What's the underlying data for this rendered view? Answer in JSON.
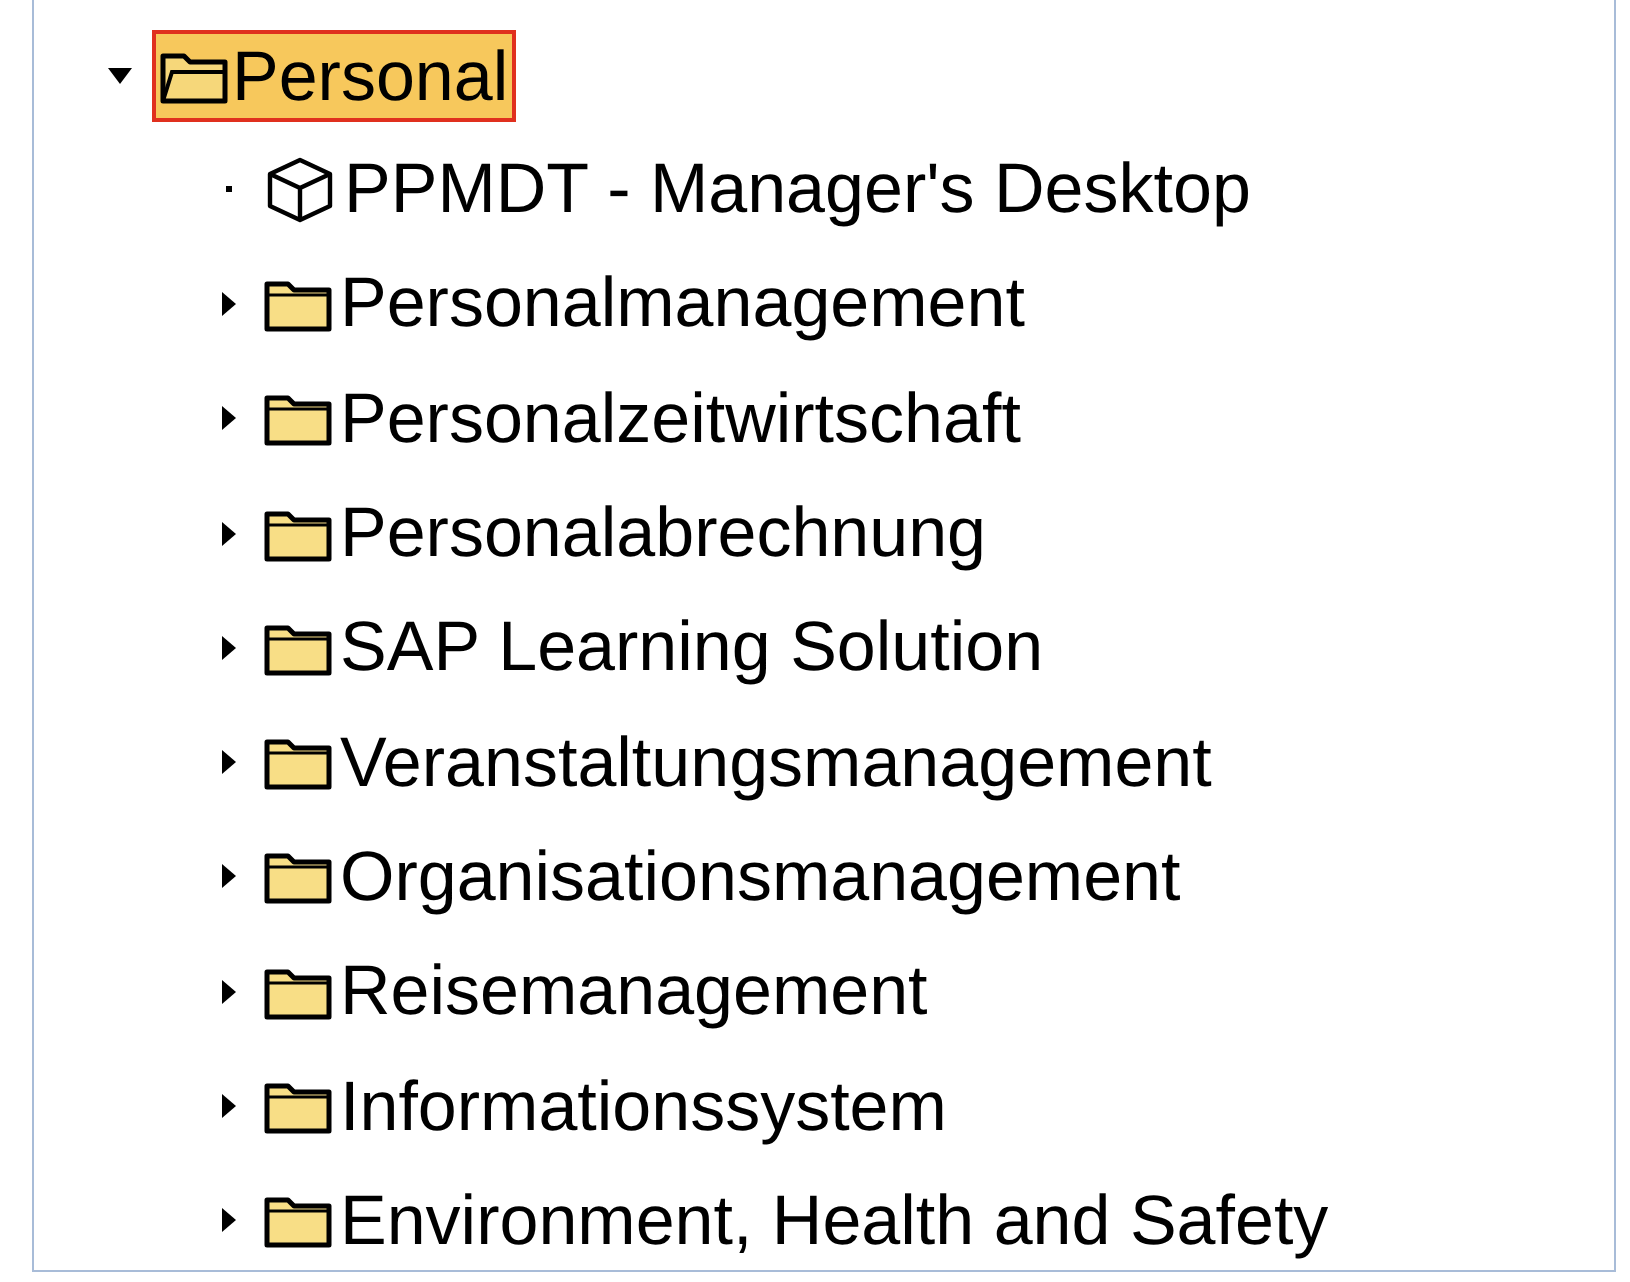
{
  "tree": {
    "label": "Personal",
    "expanded": true,
    "selected": true,
    "children": [
      {
        "label": "PPMDT - Manager's Desktop",
        "kind": "transaction"
      },
      {
        "label": "Personalmanagement",
        "kind": "folder",
        "expanded": false
      },
      {
        "label": "Personalzeitwirtschaft",
        "kind": "folder",
        "expanded": false
      },
      {
        "label": "Personalabrechnung",
        "kind": "folder",
        "expanded": false
      },
      {
        "label": "SAP Learning Solution",
        "kind": "folder",
        "expanded": false
      },
      {
        "label": "Veranstaltungsmanagement",
        "kind": "folder",
        "expanded": false
      },
      {
        "label": "Organisationsmanagement",
        "kind": "folder",
        "expanded": false
      },
      {
        "label": "Reisemanagement",
        "kind": "folder",
        "expanded": false
      },
      {
        "label": "Informationssystem",
        "kind": "folder",
        "expanded": false
      },
      {
        "label": "Environment, Health and Safety",
        "kind": "folder",
        "expanded": false
      }
    ]
  }
}
